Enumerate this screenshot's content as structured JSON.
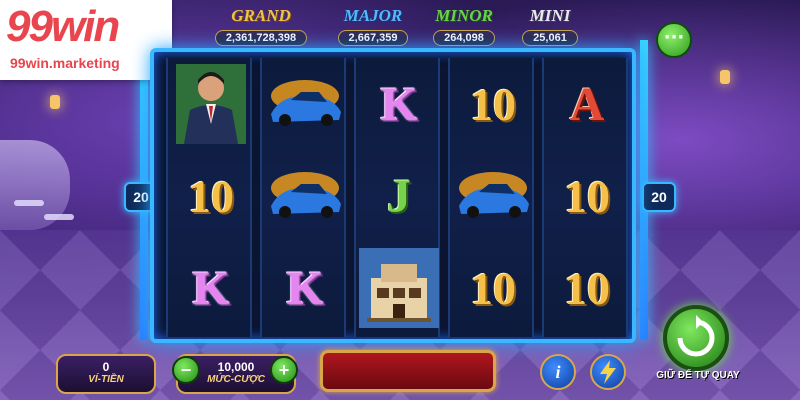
{
  "brand": {
    "logo_text": "99win",
    "logo_url_text": "99win.marketing"
  },
  "jackpots": [
    {
      "name": "GRAND",
      "value": "2,361,728,398",
      "color": "#f0c24a"
    },
    {
      "name": "MAJOR",
      "value": "2,667,359",
      "color": "#54b8ff"
    },
    {
      "name": "MINOR",
      "value": "264,098",
      "color": "#6ad24a"
    },
    {
      "name": "MINI",
      "value": "25,061",
      "color": "#e9e9f5"
    }
  ],
  "menu_button": {
    "label": "···",
    "icon": "more-icon"
  },
  "paylines": {
    "left": "20",
    "right": "20"
  },
  "reels": [
    [
      {
        "symbol": "businessman",
        "text": ""
      },
      {
        "symbol": "letter",
        "text": "10"
      },
      {
        "symbol": "letter",
        "text": "K"
      }
    ],
    [
      {
        "symbol": "sports-car",
        "text": ""
      },
      {
        "symbol": "sports-car",
        "text": ""
      },
      {
        "symbol": "letter",
        "text": "K"
      }
    ],
    [
      {
        "symbol": "letter",
        "text": "K"
      },
      {
        "symbol": "letter",
        "text": "J"
      },
      {
        "symbol": "mansion",
        "text": ""
      }
    ],
    [
      {
        "symbol": "letter",
        "text": "10"
      },
      {
        "symbol": "sports-car",
        "text": ""
      },
      {
        "symbol": "letter",
        "text": "10"
      }
    ],
    [
      {
        "symbol": "letter",
        "text": "A"
      },
      {
        "symbol": "letter",
        "text": "10"
      },
      {
        "symbol": "letter",
        "text": "10"
      }
    ]
  ],
  "balance": {
    "value": "0",
    "label": "VÍ-TIỀN"
  },
  "bet": {
    "value": "10,000",
    "label": "MỨC-CƯỢC",
    "minus": "−",
    "plus": "+"
  },
  "info_button": {
    "label": "i"
  },
  "turbo_button": {
    "icon": "lightning-icon"
  },
  "auto_spin": {
    "label": "GIỮ ĐỂ TỰ QUAY",
    "icon": "refresh-icon"
  }
}
